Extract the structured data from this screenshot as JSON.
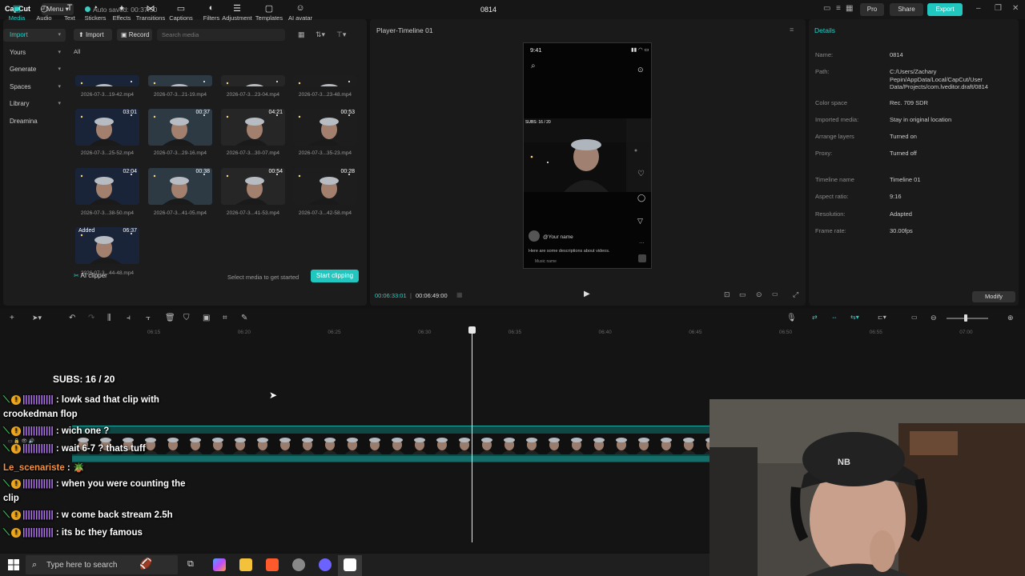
{
  "topbar": {
    "logo": "CapCut",
    "menu": "Menu",
    "autosave": "Auto saved: 00:37:50",
    "project_name": "0814",
    "pro": "Pro",
    "share": "Share",
    "export": "Export"
  },
  "toolbar": {
    "tabs": [
      {
        "label": "Media",
        "icon": "media-icon"
      },
      {
        "label": "Audio",
        "icon": "audio-icon"
      },
      {
        "label": "Text",
        "icon": "text-icon"
      },
      {
        "label": "Stickers",
        "icon": "stickers-icon"
      },
      {
        "label": "Effects",
        "icon": "effects-icon"
      },
      {
        "label": "Transitions",
        "icon": "transitions-icon"
      },
      {
        "label": "Captions",
        "icon": "captions-icon"
      },
      {
        "label": "Filters",
        "icon": "filters-icon"
      },
      {
        "label": "Adjustment",
        "icon": "adjustment-icon"
      },
      {
        "label": "Templates",
        "icon": "templates-icon"
      },
      {
        "label": "AI avatar",
        "icon": "ai-avatar-icon"
      }
    ]
  },
  "left_nav": {
    "items": [
      "Import",
      "Yours",
      "Generate",
      "Spaces",
      "Library",
      "Dreamina"
    ]
  },
  "media": {
    "import": "Import",
    "record": "Record",
    "search_placeholder": "Search media",
    "all": "All",
    "clips": [
      {
        "name": "2026-07-3...19-42.mp4",
        "duration": ""
      },
      {
        "name": "2026-07-3...21-19.mp4",
        "duration": ""
      },
      {
        "name": "2026-07-3...23-04.mp4",
        "duration": ""
      },
      {
        "name": "2026-07-3...23-48.mp4",
        "duration": ""
      },
      {
        "name": "2026-07-3...25-52.mp4",
        "duration": "03:01"
      },
      {
        "name": "2026-07-3...29-16.mp4",
        "duration": "00:37"
      },
      {
        "name": "2026-07-3...30-07.mp4",
        "duration": "04:21"
      },
      {
        "name": "2026-07-3...35-23.mp4",
        "duration": "00:53"
      },
      {
        "name": "2026-07-3...38-50.mp4",
        "duration": "02:04"
      },
      {
        "name": "2026-07-3...41-05.mp4",
        "duration": "00:38"
      },
      {
        "name": "2026-07-3...41-53.mp4",
        "duration": "00:54"
      },
      {
        "name": "2026-07-3...42-58.mp4",
        "duration": "00:28"
      },
      {
        "name": "2026-07-3...44-48.mp4",
        "duration": "06:37",
        "added": "Added"
      }
    ],
    "ai_clipper": "AI clipper",
    "select_hint": "Select media to get started",
    "start_clipping": "Start clipping"
  },
  "player": {
    "title": "Player-Timeline 01",
    "phone_time": "9:41",
    "your_name": "@Your name",
    "description": "Here are some descriptions about videos.",
    "music": "Music name",
    "current_time": "00:06:33:01",
    "total_time": "00:06:49:00"
  },
  "details": {
    "title": "Details",
    "rows": [
      {
        "label": "Name:",
        "value": "0814"
      },
      {
        "label": "Path:",
        "value": "C:/Users/Zachary Pepin/AppData/Local/CapCut/User Data/Projects/com.lveditor.draft/0814"
      },
      {
        "label": "Color space",
        "value": "Rec. 709 SDR"
      },
      {
        "label": "Imported media:",
        "value": "Stay in original location"
      },
      {
        "label": "Arrange layers",
        "value": "Turned on"
      },
      {
        "label": "Proxy:",
        "value": "Turned off"
      },
      {
        "label": "Timeline name",
        "value": "Timeline 01"
      },
      {
        "label": "Aspect ratio:",
        "value": "9:16"
      },
      {
        "label": "Resolution:",
        "value": "Adapted"
      },
      {
        "label": "Frame rate:",
        "value": "30.00fps"
      }
    ],
    "modify": "Modify"
  },
  "timeline": {
    "ticks": [
      "06:15",
      "06:20",
      "06:25",
      "06:30",
      "06:35",
      "06:40",
      "06:45",
      "06:50",
      "06:55",
      "07:00"
    ]
  },
  "chat": {
    "subs": "SUBS: 16 / 20",
    "messages": [
      {
        "user": "||||||||||||",
        "text": " : lowk sad that clip with",
        "cont": "crookedman flop"
      },
      {
        "user": "||||||||||||",
        "text": " : wich one ?"
      },
      {
        "user": "||||||||||||",
        "text": " : wait 6-7 ? thats tuff"
      },
      {
        "user": "Le_scenariste",
        "text": " : ",
        "emote": "🪴"
      },
      {
        "user": "||||||||||||",
        "text": " : when you were counting the",
        "cont": "clip"
      },
      {
        "user": "||||||||||||",
        "text": " : w come back stream 2.5h"
      },
      {
        "user": "||||||||||||",
        "text": " : its bc they famous"
      }
    ]
  },
  "taskbar": {
    "search_placeholder": "Type here to search"
  }
}
